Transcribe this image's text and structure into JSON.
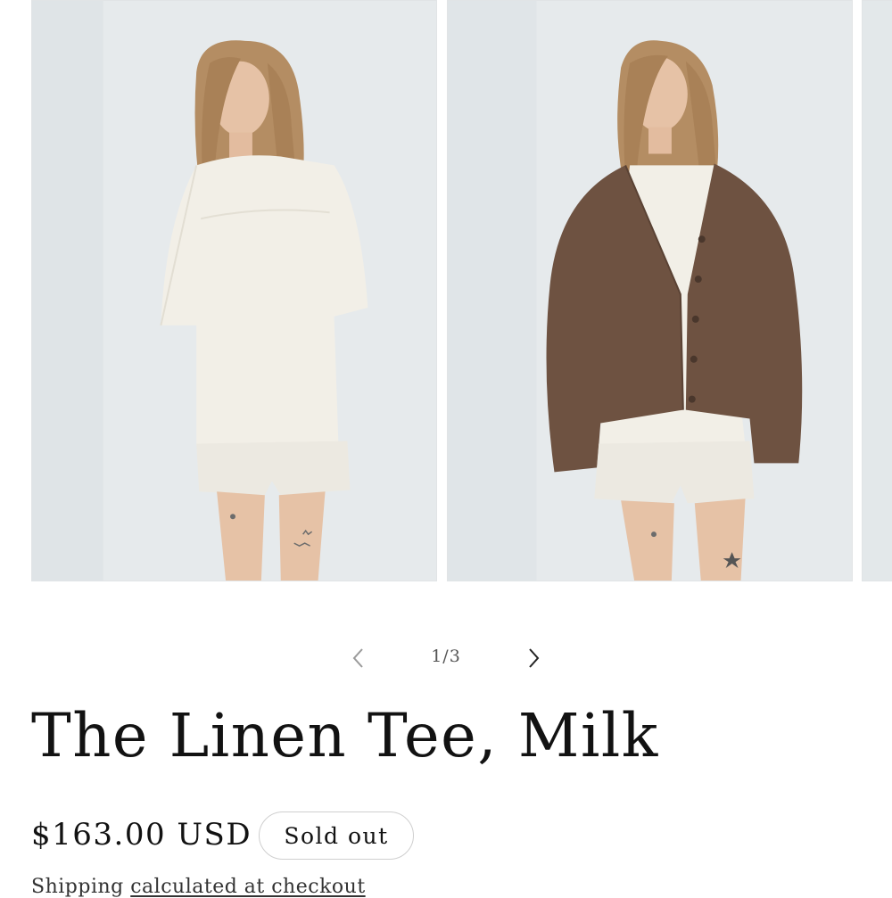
{
  "gallery": {
    "slides": [
      {
        "name": "model-linen-tee-front"
      },
      {
        "name": "model-linen-tee-with-cardigan"
      },
      {
        "name": "next-slide-peek"
      }
    ],
    "pager": {
      "prev_icon": "chevron-left-icon",
      "next_icon": "chevron-right-icon",
      "counter": "1/3",
      "current": 1,
      "total": 3
    }
  },
  "product": {
    "title": "The Linen Tee, Milk",
    "price": "$163.00 USD",
    "badge": "Sold out",
    "shipping_text": "Shipping",
    "shipping_link": "calculated at checkout"
  },
  "colors": {
    "text": "#121212",
    "photo_background": "#e7ebed",
    "badge_border": "#cfcfcf"
  }
}
